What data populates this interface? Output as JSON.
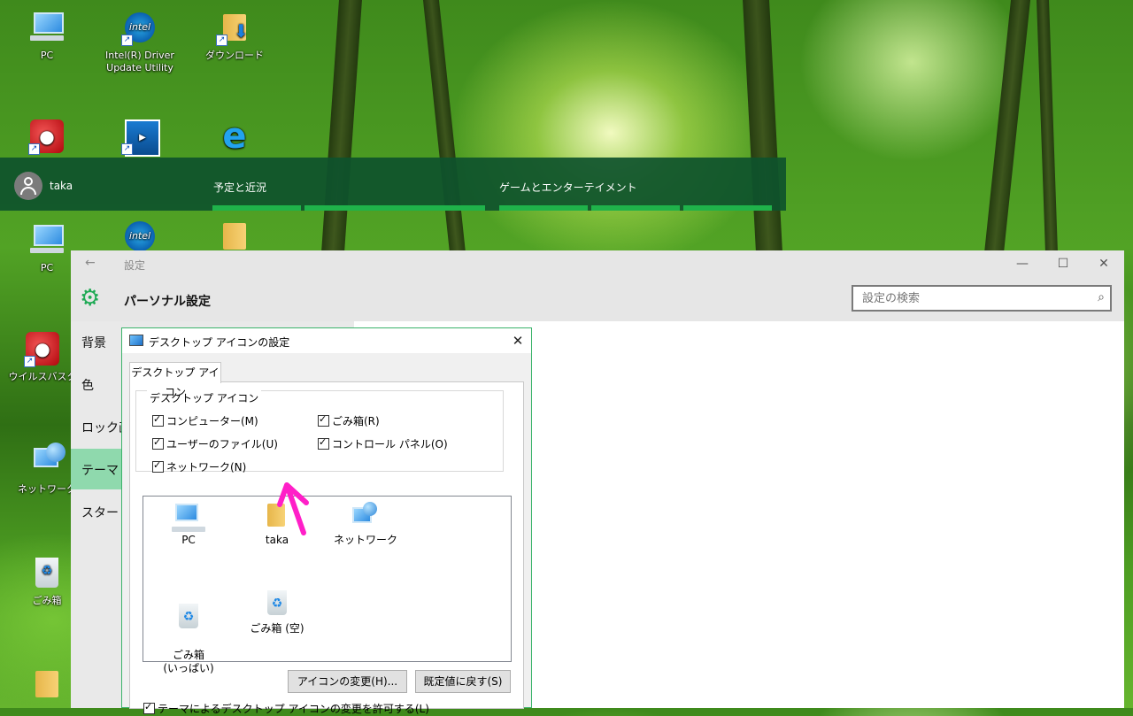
{
  "desktop": {
    "icons": [
      {
        "label": "PC"
      },
      {
        "label": "Intel(R) Driver Update Utility"
      },
      {
        "label": "ダウンロード"
      },
      {
        "label": "PC"
      },
      {
        "label": "ウイルスバスタ"
      },
      {
        "label": "ネットワーク"
      },
      {
        "label": "ごみ箱"
      }
    ]
  },
  "start": {
    "user_name": "taka",
    "group1": "予定と近況",
    "group2": "ゲームとエンターテイメント"
  },
  "settings": {
    "window_title": "設定",
    "page_title": "パーソナル設定",
    "search_placeholder": "設定の検索",
    "nav": [
      "背景",
      "色",
      "ロック画",
      "テーマ",
      "スタート"
    ],
    "selected_nav": "テーマ"
  },
  "dialog": {
    "title": "デスクトップ アイコンの設定",
    "tab": "デスクトップ アイコン",
    "group_label": "デスクトップ アイコン",
    "checkboxes": [
      {
        "label": "コンピューター(M)",
        "checked": true
      },
      {
        "label": "ごみ箱(R)",
        "checked": true
      },
      {
        "label": "ユーザーのファイル(U)",
        "checked": true
      },
      {
        "label": "コントロール パネル(O)",
        "checked": true
      },
      {
        "label": "ネットワーク(N)",
        "checked": true
      }
    ],
    "icons": [
      {
        "label": "PC"
      },
      {
        "label": "taka"
      },
      {
        "label": "ネットワーク"
      },
      {
        "label": "ごみ箱\n(いっぱい)"
      },
      {
        "label": "ごみ箱 (空)"
      }
    ],
    "change_icon_button": "アイコンの変更(H)...",
    "restore_default_button": "既定値に戻す(S)",
    "allow_themes_checkbox": "テーマによるデスクトップ アイコンの変更を許可する(L)"
  },
  "colors": {
    "accent_green": "#1faa55",
    "annotation_arrow": "#ff1fc8"
  }
}
